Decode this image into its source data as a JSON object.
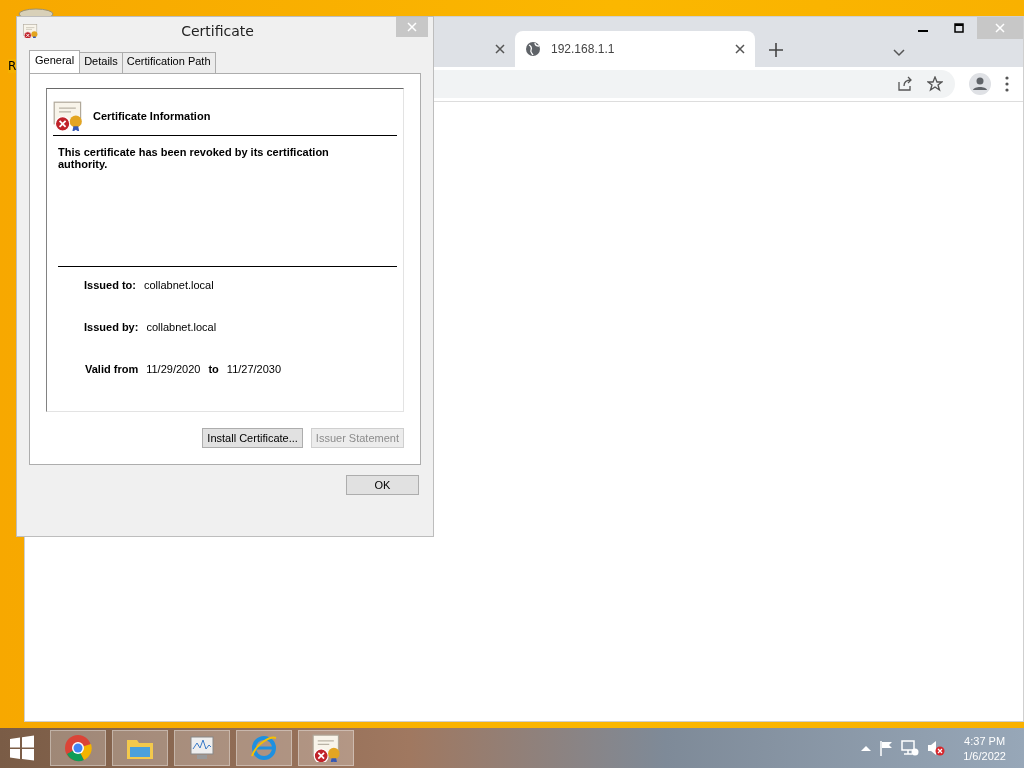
{
  "desktop": {
    "icon_label": "R"
  },
  "browser": {
    "tabs": [
      {
        "selected": false
      },
      {
        "selected": true,
        "title": "192.168.1.1"
      }
    ]
  },
  "dialog": {
    "title": "Certificate",
    "tabs": [
      {
        "label": "General",
        "selected": true
      },
      {
        "label": "Details",
        "selected": false
      },
      {
        "label": "Certification Path",
        "selected": false
      }
    ],
    "heading": "Certificate Information",
    "message": "This certificate has been revoked by its certification authority.",
    "issued_to": {
      "label": "Issued to:",
      "value": "collabnet.local"
    },
    "issued_by": {
      "label": "Issued by:",
      "value": "collabnet.local"
    },
    "validity": {
      "label": "Valid from",
      "from": "11/29/2020",
      "to_label": "to",
      "to": "11/27/2030"
    },
    "buttons": [
      {
        "label": "Install Certificate...",
        "disabled": false
      },
      {
        "label": "Issuer Statement",
        "disabled": true
      }
    ],
    "ok": "OK"
  },
  "taskbar": {
    "apps": [
      {
        "kind": "chrome"
      },
      {
        "kind": "folder"
      },
      {
        "kind": "monitor"
      },
      {
        "kind": "ie"
      },
      {
        "kind": "certificate"
      }
    ],
    "time": "4:37 PM",
    "date": "1/6/2022"
  }
}
